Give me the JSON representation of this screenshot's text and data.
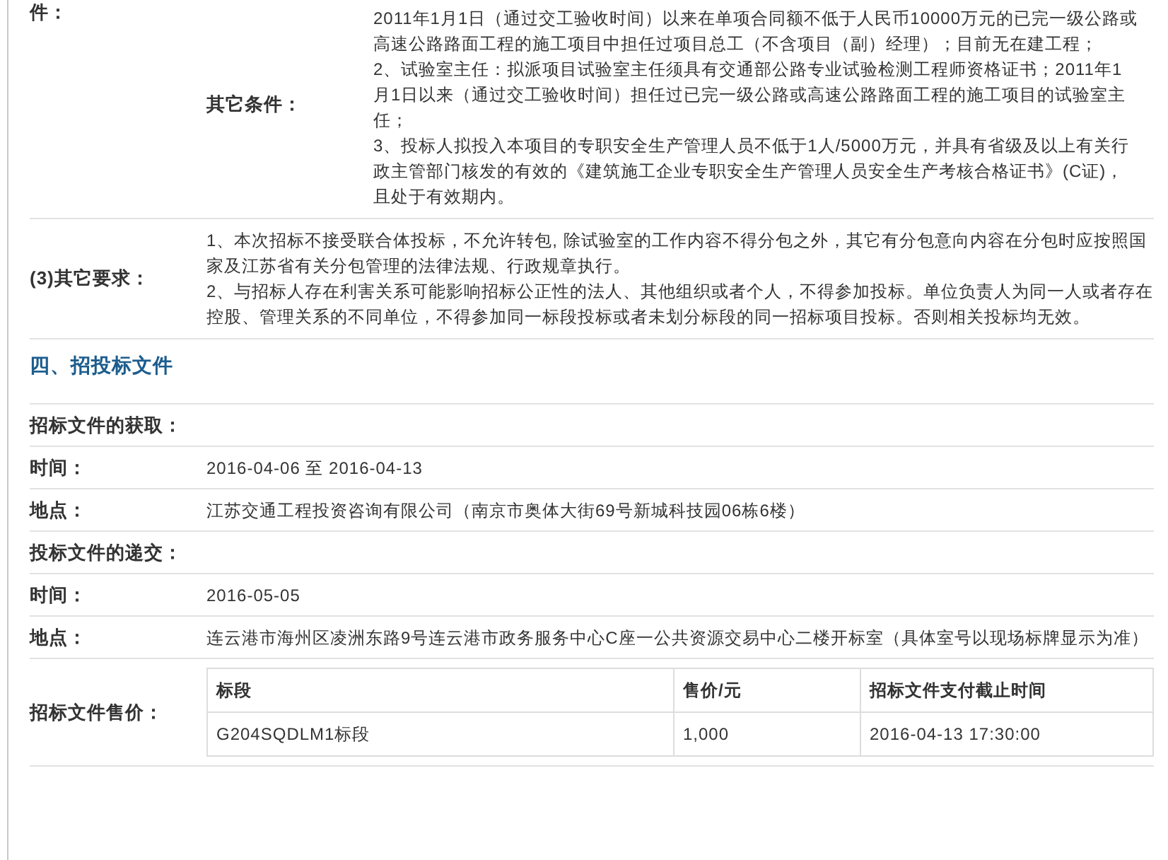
{
  "conditions_row": {
    "label": "件：",
    "sub_label": "其它条件：",
    "paragraphs": [
      "2011年1月1日（通过交工验收时间）以来在单项合同额不低于人民币10000万元的已完一级公路或高速公路路面工程的施工项目中担任过项目总工（不含项目（副）经理）；目前无在建工程；",
      "2、试验室主任：拟派项目试验室主任须具有交通部公路专业试验检测工程师资格证书；2011年1月1日以来（通过交工验收时间）担任过已完一级公路或高速公路路面工程的施工项目的试验室主任；",
      "3、投标人拟投入本项目的专职安全生产管理人员不低于1人/5000万元，并具有省级及以上有关行政主管部门核发的有效的《建筑施工企业专职安全生产管理人员安全生产考核合格证书》(C证)，且处于有效期内。"
    ]
  },
  "other_requirements": {
    "label": "(3)其它要求：",
    "paragraphs": [
      "1、本次招标不接受联合体投标，不允许转包, 除试验室的工作内容不得分包之外，其它有分包意向内容在分包时应按照国家及江苏省有关分包管理的法律法规、行政规章执行。",
      "2、与招标人存在利害关系可能影响招标公正性的法人、其他组织或者个人，不得参加投标。单位负责人为同一人或者存在控股、管理关系的不同单位，不得参加同一标段投标或者未划分标段的同一招标项目投标。否则相关投标均无效。"
    ]
  },
  "section_title": "四、招投标文件",
  "rows": [
    {
      "kind": "heading",
      "label": "招标文件的获取："
    },
    {
      "kind": "field",
      "label": "时间：",
      "value": "2016-04-06 至 2016-04-13"
    },
    {
      "kind": "field",
      "label": "地点：",
      "value": "江苏交通工程投资咨询有限公司（南京市奥体大街69号新城科技园06栋6楼）"
    },
    {
      "kind": "heading",
      "label": "投标文件的递交："
    },
    {
      "kind": "field",
      "label": "时间：",
      "value": "2016-05-05"
    },
    {
      "kind": "field",
      "label": "地点：",
      "value": "连云港市海州区凌洲东路9号连云港市政务服务中心C座一公共资源交易中心二楼开标室（具体室号以现场标牌显示为准）"
    }
  ],
  "price": {
    "label": "招标文件售价：",
    "columns": [
      "标段",
      "售价/元",
      "招标文件支付截止时间"
    ],
    "rows": [
      [
        "G204SQDLM1标段",
        "1,000",
        "2016-04-13 17:30:00"
      ]
    ]
  }
}
